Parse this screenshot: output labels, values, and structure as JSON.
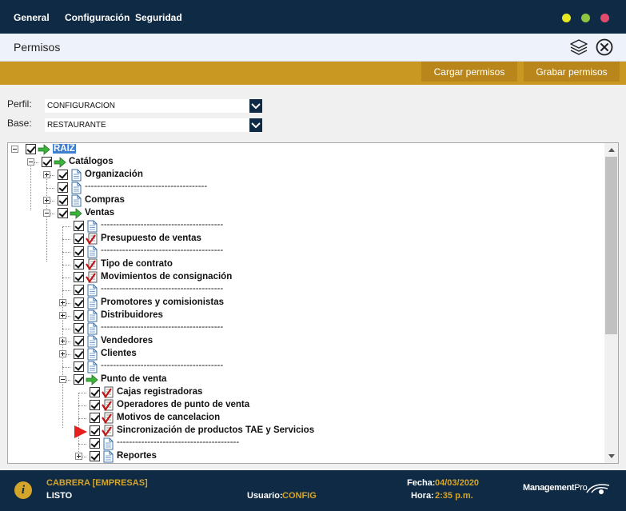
{
  "menu": {
    "items": [
      "General",
      "Configuración",
      "Seguridad"
    ]
  },
  "window": {
    "title": "Permisos"
  },
  "toolbar": {
    "cargar_label": "Cargar permisos",
    "grabar_label": "Grabar permisos"
  },
  "form": {
    "perfil_label": "Perfil:",
    "perfil_value": "CONFIGURACION",
    "base_label": "Base:",
    "base_value": "RESTAURANTE"
  },
  "tree": {
    "separator_text": "----------------------------------------",
    "nodes": [
      {
        "label": "RAIZ",
        "depth": 0,
        "expander": "minus",
        "icon": "arrow",
        "selected": true
      },
      {
        "label": "Catálogos",
        "depth": 1,
        "expander": "minus",
        "icon": "arrow"
      },
      {
        "label": "Organización",
        "depth": 2,
        "expander": "plus",
        "icon": "doc"
      },
      {
        "label": "----------------------------------------",
        "depth": 2,
        "expander": "none",
        "icon": "doc",
        "separator": true
      },
      {
        "label": "Compras",
        "depth": 2,
        "expander": "plus",
        "icon": "doc"
      },
      {
        "label": "Ventas",
        "depth": 2,
        "expander": "minus",
        "icon": "arrow"
      },
      {
        "label": "----------------------------------------",
        "depth": 3,
        "expander": "none",
        "icon": "doc",
        "separator": true
      },
      {
        "label": "Presupuesto de ventas",
        "depth": 3,
        "expander": "none",
        "icon": "form"
      },
      {
        "label": "----------------------------------------",
        "depth": 3,
        "expander": "none",
        "icon": "doc",
        "separator": true
      },
      {
        "label": "Tipo de contrato",
        "depth": 3,
        "expander": "none",
        "icon": "form"
      },
      {
        "label": "Movimientos de consignación",
        "depth": 3,
        "expander": "none",
        "icon": "form"
      },
      {
        "label": "----------------------------------------",
        "depth": 3,
        "expander": "none",
        "icon": "doc",
        "separator": true
      },
      {
        "label": "Promotores y comisionistas",
        "depth": 3,
        "expander": "plus",
        "icon": "doc"
      },
      {
        "label": "Distribuidores",
        "depth": 3,
        "expander": "plus",
        "icon": "doc"
      },
      {
        "label": "----------------------------------------",
        "depth": 3,
        "expander": "none",
        "icon": "doc",
        "separator": true
      },
      {
        "label": "Vendedores",
        "depth": 3,
        "expander": "plus",
        "icon": "doc"
      },
      {
        "label": "Clientes",
        "depth": 3,
        "expander": "plus",
        "icon": "doc"
      },
      {
        "label": "----------------------------------------",
        "depth": 3,
        "expander": "none",
        "icon": "doc",
        "separator": true
      },
      {
        "label": "Punto de venta",
        "depth": 3,
        "expander": "minus",
        "icon": "arrow"
      },
      {
        "label": "Cajas registradoras",
        "depth": 4,
        "expander": "none",
        "icon": "form"
      },
      {
        "label": "Operadores de punto de venta",
        "depth": 4,
        "expander": "none",
        "icon": "form"
      },
      {
        "label": "Motivos de cancelacion",
        "depth": 4,
        "expander": "none",
        "icon": "form"
      },
      {
        "label": "Sincronización de productos TAE y Servicios",
        "depth": 4,
        "expander": "none",
        "icon": "form",
        "pointer": true
      },
      {
        "label": "----------------------------------------",
        "depth": 4,
        "expander": "none",
        "icon": "doc",
        "separator": true
      },
      {
        "label": "Reportes",
        "depth": 4,
        "expander": "plus",
        "icon": "doc"
      }
    ]
  },
  "status": {
    "company": "CABRERA [EMPRESAS]",
    "state": "LISTO",
    "user_label": "Usuario:",
    "user_value": "CONFIG",
    "date_label": "Fecha:",
    "date_value": "04/03/2020",
    "time_label": "Hora:",
    "time_value": "2:35 p.m.",
    "logo_text": "Management",
    "logo_suffix": "Pro"
  },
  "colors": {
    "navy": "#0f2a44",
    "gold": "#c99820",
    "accent_text": "#d4a52a",
    "selection": "#3f7fd0"
  }
}
